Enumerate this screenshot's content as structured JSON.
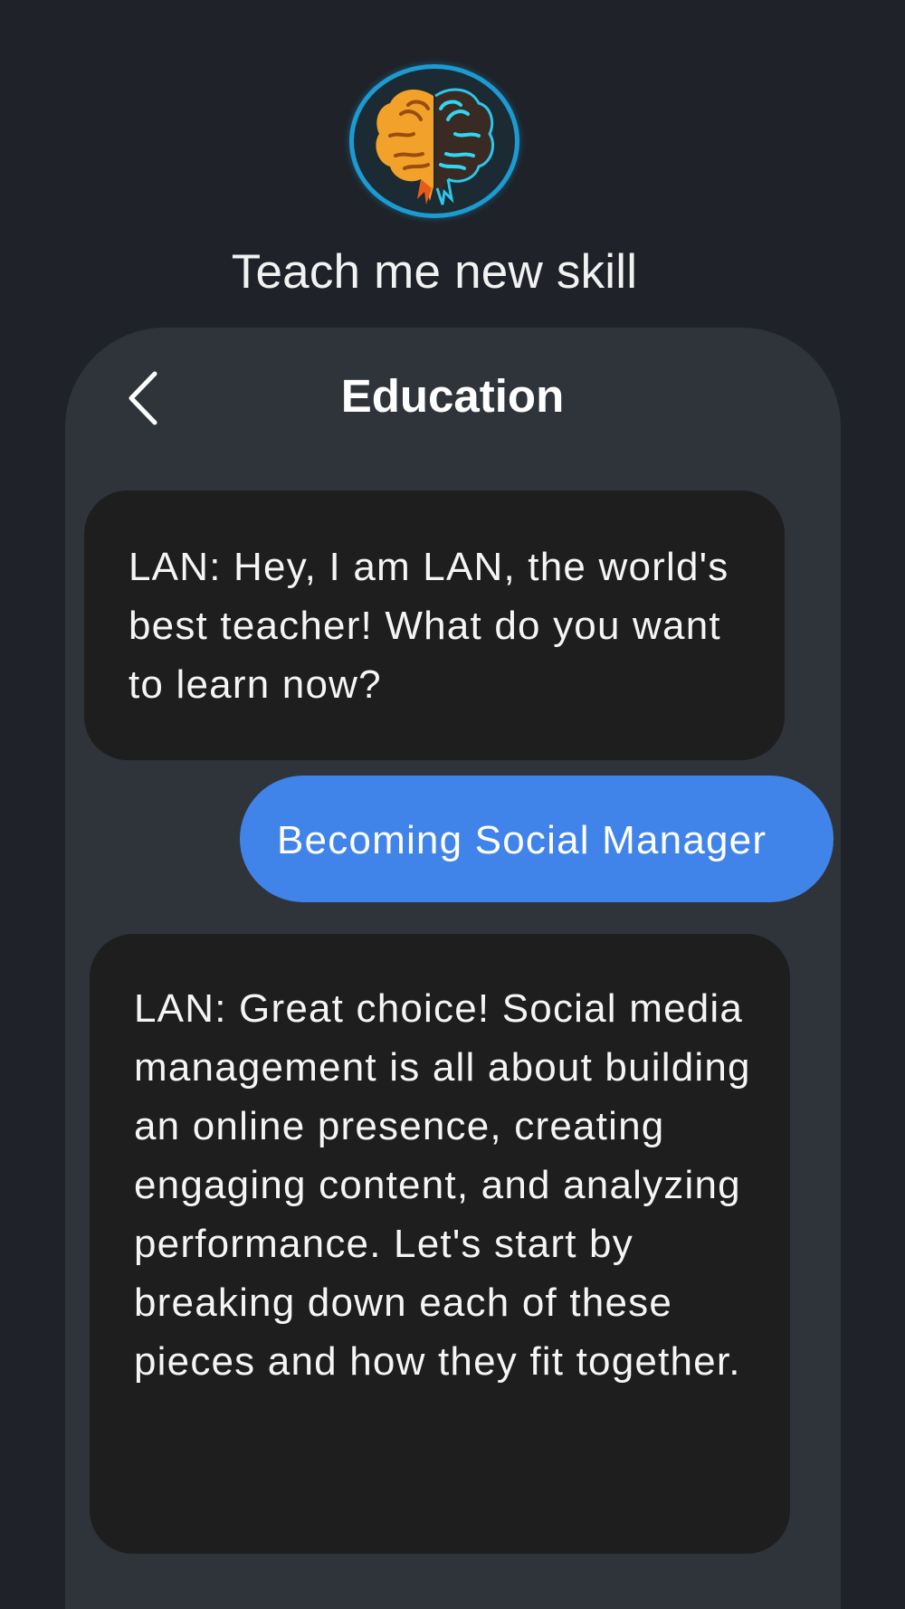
{
  "header": {
    "app_logo": "brain-logo-icon",
    "app_title": "Teach me new skill"
  },
  "chat": {
    "title": "Education",
    "back_icon": "chevron-left-icon",
    "messages": [
      {
        "sender": "bot",
        "text": "LAN: Hey, I am LAN, the world's best teacher! What do you want to learn now?"
      },
      {
        "sender": "user",
        "text": "Becoming Social Manager"
      },
      {
        "sender": "bot",
        "text": "LAN: Great choice! Social media management is all about building an online presence, creating engaging content, and analyzing performance. Let's start by breaking down each of these pieces and how they fit together."
      }
    ]
  },
  "colors": {
    "background": "#1f2229",
    "panel": "#2f343b",
    "bot_bubble": "#1e1e1f",
    "user_bubble": "#4184e9",
    "logo_ring": "#1c9ad2"
  }
}
